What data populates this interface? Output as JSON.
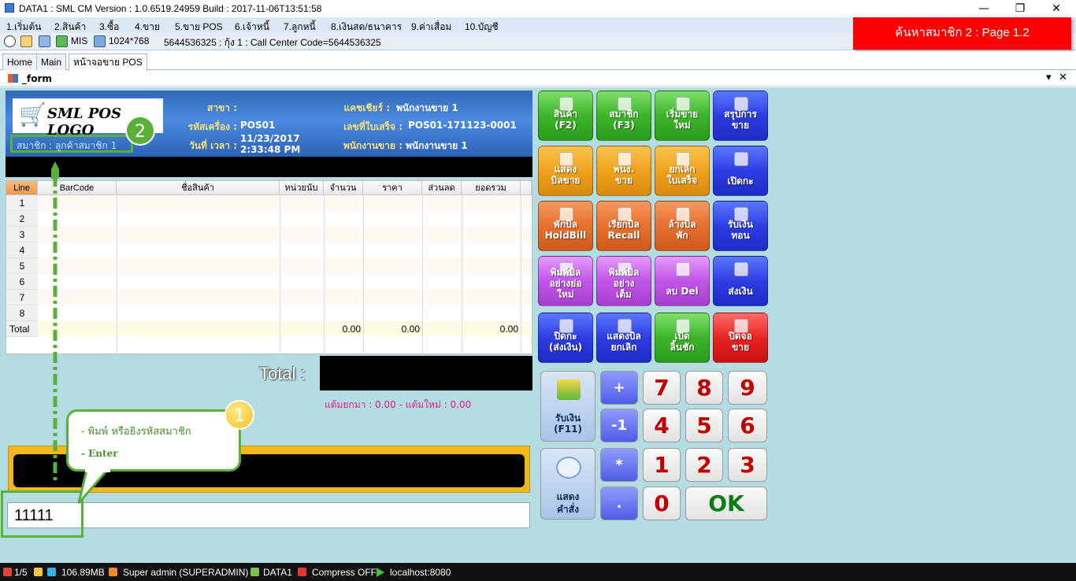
{
  "window": {
    "title": "DATA1 : SML CM Version : 1.0.6519.24959  Build : 2017-11-06T13:51:58",
    "minimize": "—",
    "restore": "❐",
    "close": "✕"
  },
  "menu": [
    "1.เริ่มต้น",
    "2.สินค้า",
    "3.ซื้อ",
    "4.ขาย",
    "5.ขาย POS",
    "6.เจ้าหนี้",
    "7.ลูกหนี้",
    "8.เงินสด/ธนาคาร",
    "9.ค่าเสื่อม",
    "10.บัญชี"
  ],
  "toolbar": {
    "mis": "MIS",
    "resolution": "1024*768",
    "info": "5644536325 : กุ้ง 1 : Call Center Code=5644536325"
  },
  "popup": "ค้นหาสมาชิก 2 : Page 1.2",
  "tabs": [
    "Home",
    "Main",
    "หน้าจอขาย POS"
  ],
  "form": {
    "title": "_form",
    "dropdown": "▾",
    "close": "✕"
  },
  "header": {
    "logo_text": "SML POS LOGO",
    "cart_icon": "🛒",
    "branch_label": "สาขา :",
    "branch_value": "",
    "machine_label": "รหัสเครื่อง :",
    "machine_value": "POS01",
    "datetime_label": "วันที่ เวลา :",
    "date_value": "11/23/2017",
    "time_value": "2:33:48 PM",
    "cashier_label": "แคชเชียร์ :",
    "cashier_value": "พนักงานขาย 1",
    "receipt_label": "เลขที่ใบเสร็จ :",
    "receipt_value": "POS01-171123-0001",
    "salesperson_label": "พนักงานขาย :",
    "salesperson_value": "พนักงานขาย 1",
    "member_text": "สมาชิก : ลูกค้าสมาชิก 1"
  },
  "grid": {
    "columns": [
      "Line",
      "BarCode",
      "ชื่อสินค้า",
      "หน่วยนับ",
      "จำนวน",
      "ราคา",
      "ส่วนลด",
      "ยอดรวม"
    ],
    "rows": [
      "1",
      "2",
      "3",
      "4",
      "5",
      "6",
      "7",
      "8"
    ],
    "total_label": "Total",
    "total_qty": "0.00",
    "total_price": "0.00",
    "total_amount": "0.00"
  },
  "total": {
    "label": "Total :",
    "value": ""
  },
  "points": "แต้มยกมา : 0.00 - แต้มใหม่ : 0.00",
  "input": {
    "value": "11111"
  },
  "annotations": {
    "callout_line1": "- พิมพ์ หรือยิงรหัสสมาชิก",
    "callout_line2": "- Enter",
    "badge1": "1",
    "badge2": "2"
  },
  "buttons": [
    {
      "l1": "สินค้า",
      "l2": "(F2)",
      "color": "green"
    },
    {
      "l1": "สมาชิก",
      "l2": "(F3)",
      "color": "green"
    },
    {
      "l1": "เริ่มขาย",
      "l2": "ใหม่",
      "color": "green"
    },
    {
      "l1": "สรุปการ",
      "l2": "ขาย",
      "color": "blue"
    },
    {
      "l1": "แสดง",
      "l2": "บิลขาย",
      "color": "orange"
    },
    {
      "l1": "พนง.",
      "l2": "ขาย",
      "color": "orange"
    },
    {
      "l1": "ยกเลิก",
      "l2": "ใบเสร็จ",
      "color": "orange"
    },
    {
      "l1": "",
      "l2": "เปิดกะ",
      "color": "blue"
    },
    {
      "l1": "พักบิล",
      "l2": "HoldBill",
      "color": "dorange"
    },
    {
      "l1": "เรียกบิล",
      "l2": "Recall",
      "color": "dorange"
    },
    {
      "l1": "ล้างบิล",
      "l2": "พัก",
      "color": "dorange"
    },
    {
      "l1": "รับเงิน",
      "l2": "ทอน",
      "color": "blue"
    },
    {
      "l1": "พิมพ์บิล",
      "l2": "อย่างย่อ",
      "l3": "ใหม่",
      "color": "purple"
    },
    {
      "l1": "พิมพ์บิล",
      "l2": "อย่าง",
      "l3": "เต็ม",
      "color": "purple"
    },
    {
      "l1": "",
      "l2": "ลบ  Del",
      "color": "purple"
    },
    {
      "l1": "",
      "l2": "ส่งเงิน",
      "color": "blue"
    },
    {
      "l1": "ปิดกะ",
      "l2": "(ส่งเงิน)",
      "color": "blue"
    },
    {
      "l1": "แสดงบิล",
      "l2": "ยกเลิก",
      "color": "blue"
    },
    {
      "l1": "เปิด",
      "l2": "ลิ้นชัก",
      "color": "green"
    },
    {
      "l1": "ปิดจอ",
      "l2": "ขาย",
      "color": "red"
    }
  ],
  "keypad": {
    "pay_label1": "รับเงิน",
    "pay_label2": "(F11)",
    "cmd_label1": "แสดง",
    "cmd_label2": "คำสั่ง",
    "plus": "+",
    "minus1": "-1",
    "star": "*",
    "dot": ".",
    "n7": "7",
    "n8": "8",
    "n9": "9",
    "n4": "4",
    "n5": "5",
    "n6": "6",
    "n1": "1",
    "n2": "2",
    "n3": "3",
    "n0": "0",
    "ok": "OK"
  },
  "status": {
    "page": "1/5",
    "memory": "106.89MB",
    "user": "Super admin (SUPERADMIN)",
    "db": "DATA1",
    "compress": "Compress OFF",
    "server": "localhost:8080"
  }
}
